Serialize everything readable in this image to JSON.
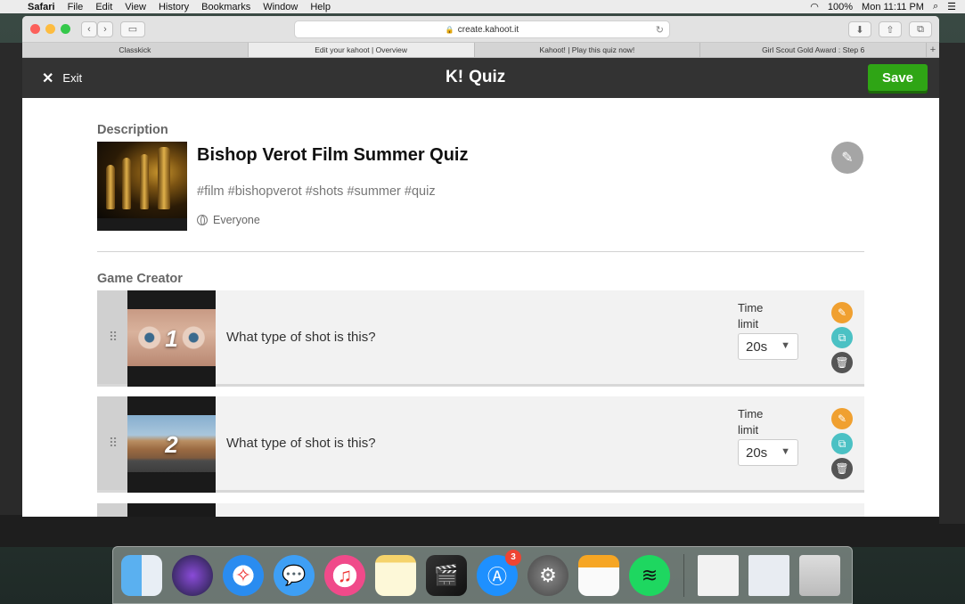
{
  "menubar": {
    "apple": "",
    "items": [
      "Safari",
      "File",
      "Edit",
      "View",
      "History",
      "Bookmarks",
      "Window",
      "Help"
    ],
    "battery": "100%",
    "clock": "Mon 11:11 PM"
  },
  "browser": {
    "url": "create.kahoot.it",
    "tabs": [
      {
        "label": "Classkick"
      },
      {
        "label": "Edit your kahoot | Overview"
      },
      {
        "label": "Kahoot! | Play this quiz now!"
      },
      {
        "label": "Girl Scout Gold Award : Step 6"
      }
    ],
    "add_tab": "+"
  },
  "header": {
    "exit_label": "Exit",
    "logo": "K!",
    "title": "Quiz",
    "save_label": "Save"
  },
  "description": {
    "section_label": "Description",
    "title": "Bishop Verot Film Summer Quiz",
    "tags": "#film #bishopverot #shots #summer #quiz",
    "visibility": "Everyone"
  },
  "game_creator": {
    "section_label": "Game Creator",
    "questions": [
      {
        "number": "1",
        "text": "What type of shot is this?",
        "time_label": "Time limit",
        "time_value": "20s"
      },
      {
        "number": "2",
        "text": "What type of shot is this?",
        "time_label": "Time limit",
        "time_value": "20s"
      }
    ]
  },
  "icons": {
    "close": "close-icon",
    "pencil": "pencil-icon",
    "duplicate": "duplicate-icon",
    "trash": "trash-icon",
    "drag": "drag-handle-icon",
    "globe": "globe-icon"
  },
  "colors": {
    "header_bg": "#333333",
    "save_green": "#2fa515",
    "edit_orange": "#f0a030",
    "duplicate_teal": "#4bc1c4"
  },
  "dock": {
    "apps": [
      "Finder",
      "Siri",
      "Safari",
      "Messages",
      "iTunes",
      "Notes",
      "Final Cut Pro",
      "App Store",
      "System Preferences",
      "Pages",
      "Spotify"
    ],
    "app_store_badge": "3"
  }
}
